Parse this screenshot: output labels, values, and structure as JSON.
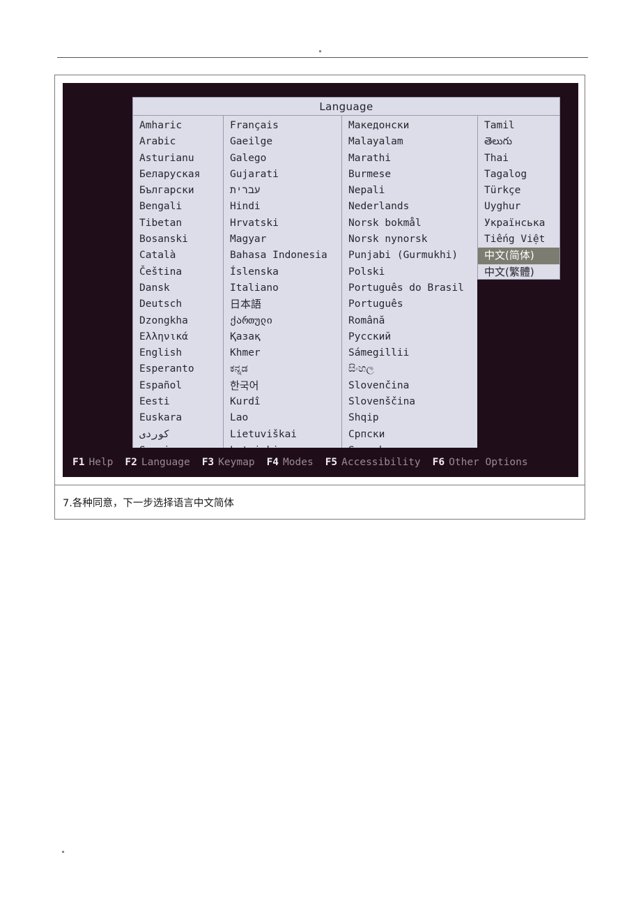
{
  "document": {
    "caption": "7.各种同意，下一步选择语言中文简体"
  },
  "terminal": {
    "dialog": {
      "title": "Language",
      "columns": [
        {
          "id": "column-1",
          "items": [
            {
              "label": "Amharic",
              "script": "latin",
              "selected": false
            },
            {
              "label": "Arabic",
              "script": "latin",
              "selected": false
            },
            {
              "label": "Asturianu",
              "script": "latin",
              "selected": false
            },
            {
              "label": "Беларуская",
              "script": "cyrillic",
              "selected": false
            },
            {
              "label": "Български",
              "script": "cyrillic",
              "selected": false
            },
            {
              "label": "Bengali",
              "script": "latin",
              "selected": false
            },
            {
              "label": "Tibetan",
              "script": "latin",
              "selected": false
            },
            {
              "label": "Bosanski",
              "script": "latin",
              "selected": false
            },
            {
              "label": "Català",
              "script": "latin",
              "selected": false
            },
            {
              "label": "Čeština",
              "script": "latin",
              "selected": false
            },
            {
              "label": "Dansk",
              "script": "latin",
              "selected": false
            },
            {
              "label": "Deutsch",
              "script": "latin",
              "selected": false
            },
            {
              "label": "Dzongkha",
              "script": "latin",
              "selected": false
            },
            {
              "label": "Ελληνικά",
              "script": "greek",
              "selected": false
            },
            {
              "label": "English",
              "script": "latin",
              "selected": false
            },
            {
              "label": "Esperanto",
              "script": "latin",
              "selected": false
            },
            {
              "label": "Español",
              "script": "latin",
              "selected": false
            },
            {
              "label": "Eesti",
              "script": "latin",
              "selected": false
            },
            {
              "label": "Euskara",
              "script": "latin",
              "selected": false
            },
            {
              "label": "کوردی",
              "script": "arabic",
              "selected": false
            },
            {
              "label": "Suomi",
              "script": "latin",
              "selected": false
            }
          ]
        },
        {
          "id": "column-2",
          "items": [
            {
              "label": "Français",
              "script": "latin",
              "selected": false
            },
            {
              "label": "Gaeilge",
              "script": "latin",
              "selected": false
            },
            {
              "label": "Galego",
              "script": "latin",
              "selected": false
            },
            {
              "label": "Gujarati",
              "script": "latin",
              "selected": false
            },
            {
              "label": "עברית",
              "script": "hebrew",
              "selected": false
            },
            {
              "label": "Hindi",
              "script": "latin",
              "selected": false
            },
            {
              "label": "Hrvatski",
              "script": "latin",
              "selected": false
            },
            {
              "label": "Magyar",
              "script": "latin",
              "selected": false
            },
            {
              "label": "Bahasa Indonesia",
              "script": "latin",
              "selected": false
            },
            {
              "label": "Íslenska",
              "script": "latin",
              "selected": false
            },
            {
              "label": "Italiano",
              "script": "latin",
              "selected": false
            },
            {
              "label": "日本語",
              "script": "cjk",
              "selected": false
            },
            {
              "label": "ქართული",
              "script": "georgian",
              "selected": false
            },
            {
              "label": "Қазақ",
              "script": "cyrillic",
              "selected": false
            },
            {
              "label": "Khmer",
              "script": "latin",
              "selected": false
            },
            {
              "label": "ಕನ್ನಡ",
              "script": "kannada",
              "selected": false
            },
            {
              "label": "한국어",
              "script": "cjk",
              "selected": false
            },
            {
              "label": "Kurdî",
              "script": "latin",
              "selected": false
            },
            {
              "label": "Lao",
              "script": "latin",
              "selected": false
            },
            {
              "label": "Lietuviškai",
              "script": "latin",
              "selected": false
            },
            {
              "label": "Latviski",
              "script": "latin",
              "selected": false
            }
          ]
        },
        {
          "id": "column-3",
          "items": [
            {
              "label": "Македонски",
              "script": "cyrillic",
              "selected": false
            },
            {
              "label": "Malayalam",
              "script": "latin",
              "selected": false
            },
            {
              "label": "Marathi",
              "script": "latin",
              "selected": false
            },
            {
              "label": "Burmese",
              "script": "latin",
              "selected": false
            },
            {
              "label": "Nepali",
              "script": "latin",
              "selected": false
            },
            {
              "label": "Nederlands",
              "script": "latin",
              "selected": false
            },
            {
              "label": "Norsk bokmål",
              "script": "latin",
              "selected": false
            },
            {
              "label": "Norsk nynorsk",
              "script": "latin",
              "selected": false
            },
            {
              "label": "Punjabi (Gurmukhi)",
              "script": "latin",
              "selected": false
            },
            {
              "label": "Polski",
              "script": "latin",
              "selected": false
            },
            {
              "label": "Português do Brasil",
              "script": "latin",
              "selected": false
            },
            {
              "label": "Português",
              "script": "latin",
              "selected": false
            },
            {
              "label": "Română",
              "script": "latin",
              "selected": false
            },
            {
              "label": "Русский",
              "script": "cyrillic",
              "selected": false
            },
            {
              "label": "Sámegillii",
              "script": "latin",
              "selected": false
            },
            {
              "label": "සිංහල",
              "script": "sinhala",
              "selected": false
            },
            {
              "label": "Slovenčina",
              "script": "latin",
              "selected": false
            },
            {
              "label": "Slovenščina",
              "script": "latin",
              "selected": false
            },
            {
              "label": "Shqip",
              "script": "latin",
              "selected": false
            },
            {
              "label": "Српски",
              "script": "cyrillic",
              "selected": false
            },
            {
              "label": "Svenska",
              "script": "latin",
              "selected": false
            }
          ]
        },
        {
          "id": "column-4",
          "items": [
            {
              "label": "Tamil",
              "script": "latin",
              "selected": false
            },
            {
              "label": "తెలుగు",
              "script": "telugu",
              "selected": false
            },
            {
              "label": "Thai",
              "script": "latin",
              "selected": false
            },
            {
              "label": "Tagalog",
              "script": "latin",
              "selected": false
            },
            {
              "label": "Türkçe",
              "script": "latin",
              "selected": false
            },
            {
              "label": "Uyghur",
              "script": "latin",
              "selected": false
            },
            {
              "label": "Українська",
              "script": "cyrillic",
              "selected": false
            },
            {
              "label": "Tiếng Việt",
              "script": "latin",
              "selected": false
            },
            {
              "label": "中文(简体)",
              "script": "cjk",
              "selected": true
            },
            {
              "label": "中文(繁體)",
              "script": "cjk",
              "selected": false
            }
          ]
        }
      ]
    },
    "function_keys": [
      {
        "key": "F1",
        "label": "Help"
      },
      {
        "key": "F2",
        "label": "Language"
      },
      {
        "key": "F3",
        "label": "Keymap"
      },
      {
        "key": "F4",
        "label": "Modes"
      },
      {
        "key": "F5",
        "label": "Accessibility"
      },
      {
        "key": "F6",
        "label": "Other Options"
      }
    ]
  },
  "colors": {
    "terminal_background": "#200d1a",
    "panel_background": "#dcdde8",
    "panel_border": "#9a9ab0",
    "selection_background": "#7c7c70",
    "selection_text": "#ffffff",
    "fkey_key": "#f2eef2",
    "fkey_label": "#988b96"
  }
}
